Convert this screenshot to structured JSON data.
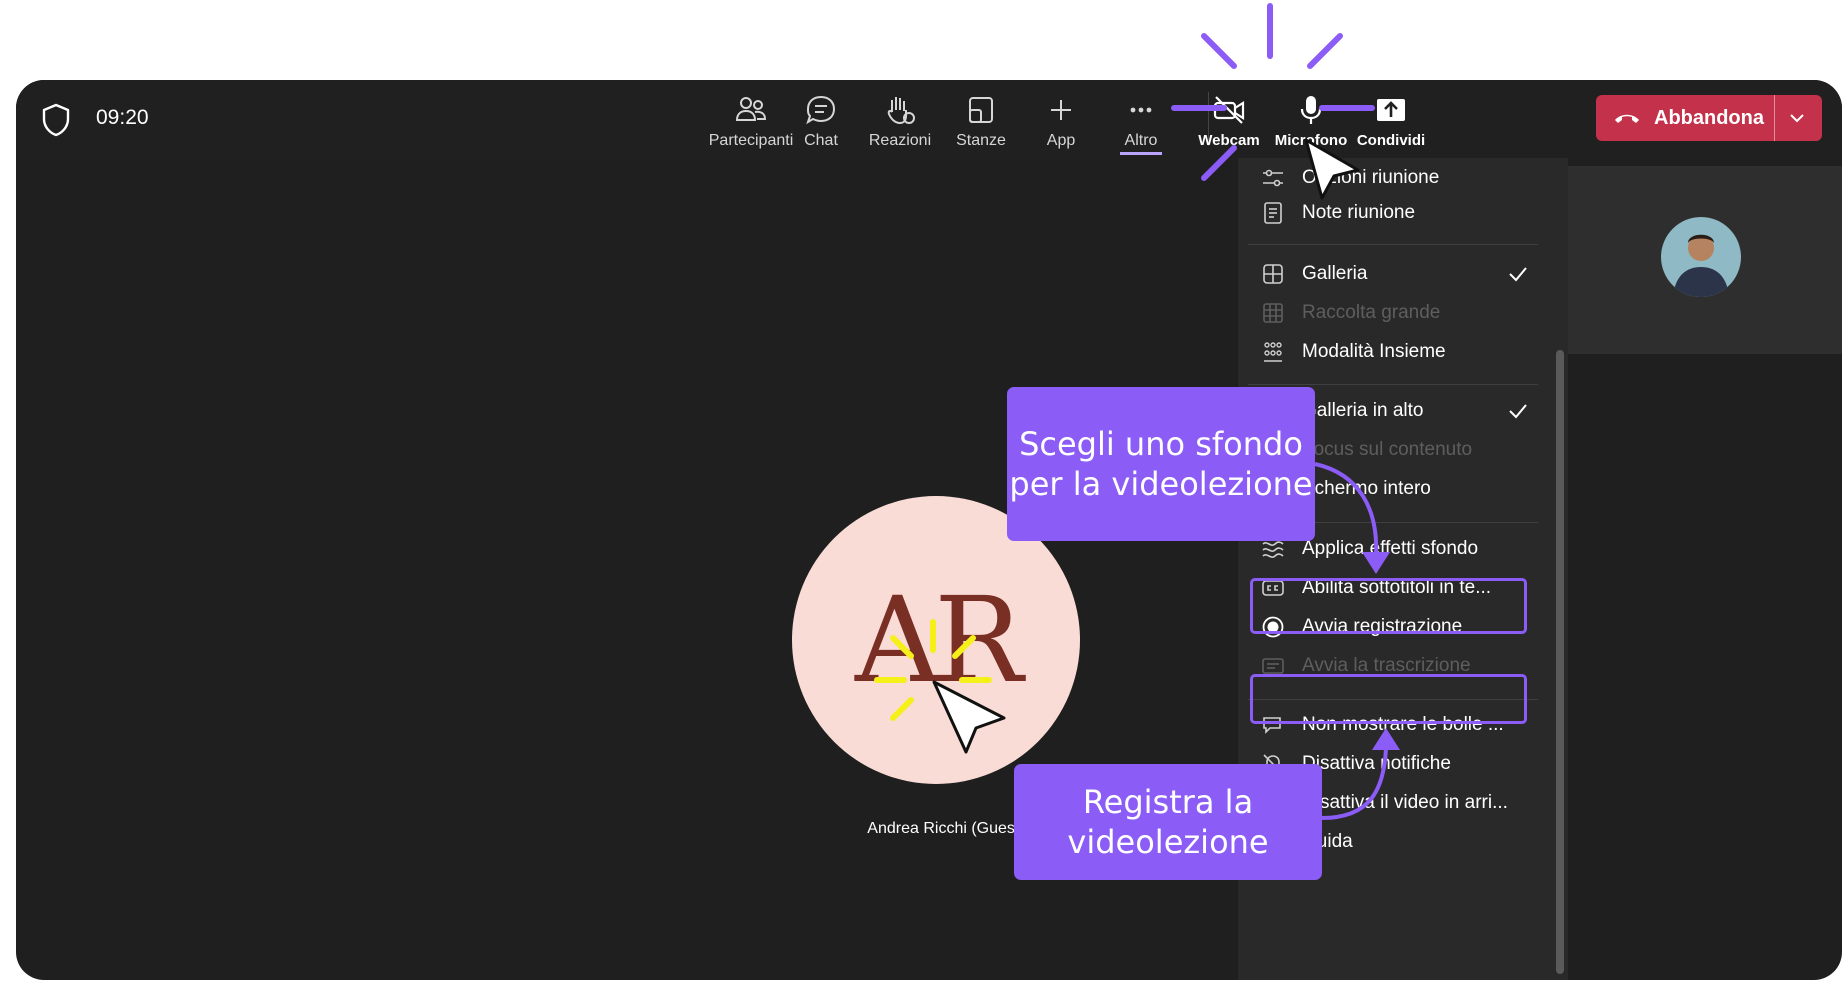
{
  "meeting": {
    "time": "09:20"
  },
  "toolbar": {
    "items": [
      {
        "label": "Partecipanti",
        "icon": "people-icon"
      },
      {
        "label": "Chat",
        "icon": "chat-icon"
      },
      {
        "label": "Reazioni",
        "icon": "raise-hand-icon"
      },
      {
        "label": "Stanze",
        "icon": "rooms-icon"
      },
      {
        "label": "App",
        "icon": "plus-icon"
      },
      {
        "label": "Altro",
        "icon": "more-icon"
      },
      {
        "label": "Webcam",
        "icon": "camera-off-icon"
      },
      {
        "label": "Microfono",
        "icon": "microphone-icon"
      },
      {
        "label": "Condividi",
        "icon": "share-icon"
      }
    ],
    "leave_label": "Abbandona"
  },
  "participant": {
    "initials": "AR",
    "name": "Andrea Ricchi (Guest)"
  },
  "menu": {
    "items": [
      {
        "label": "Opzioni riunione",
        "icon": "settings-sliders-icon"
      },
      {
        "label": "Note riunione",
        "icon": "notes-icon"
      },
      {
        "label": "Galleria",
        "icon": "grid-icon",
        "checked": true
      },
      {
        "label": "Raccolta grande",
        "icon": "large-grid-icon",
        "disabled": true
      },
      {
        "label": "Modalità Insieme",
        "icon": "together-mode-icon"
      },
      {
        "label": "Galleria in alto",
        "icon": "gallery-top-icon",
        "checked": true
      },
      {
        "label": "Focus sul contenuto",
        "icon": "focus-icon",
        "disabled": true
      },
      {
        "label": "Schermo intero",
        "icon": "fullscreen-icon"
      },
      {
        "label": "Applica effetti sfondo",
        "icon": "background-effects-icon"
      },
      {
        "label": "Abilita sottotitoli in te...",
        "icon": "captions-icon"
      },
      {
        "label": "Avvia registrazione",
        "icon": "record-icon"
      },
      {
        "label": "Avvia la trascrizione",
        "icon": "transcript-icon",
        "disabled": true
      },
      {
        "label": "Non mostrare le bolle ...",
        "icon": "bubbles-icon"
      },
      {
        "label": "Disattiva notifiche",
        "icon": "notification-off-icon"
      },
      {
        "label": "Disattiva il video in arri...",
        "icon": "video-off-icon"
      },
      {
        "label": "Guida",
        "icon": "help-icon"
      }
    ]
  },
  "callouts": {
    "background": "Scegli uno sfondo per la videolezione",
    "record": "Registra la videolezione"
  },
  "colors": {
    "accent": "#8b5cf6",
    "leave": "#c4314b",
    "window": "#1f1f1f",
    "menu": "#292929",
    "avatar_bg": "#f9dcd6",
    "avatar_text": "#7a2f25",
    "sparkle": "#f5ef1a"
  }
}
